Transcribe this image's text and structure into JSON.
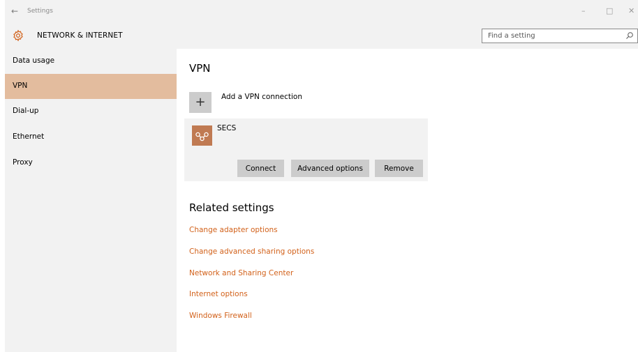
{
  "window": {
    "title": "Settings",
    "back_glyph": "←",
    "minimize_glyph": "–",
    "maximize_glyph": "□",
    "close_glyph": "✕"
  },
  "header": {
    "title": "NETWORK & INTERNET",
    "icon": "gear-icon"
  },
  "search": {
    "placeholder": "Find a setting",
    "value": "",
    "icon": "search-icon"
  },
  "sidebar": {
    "items": [
      {
        "label": "Data usage",
        "active": false
      },
      {
        "label": "VPN",
        "active": true
      },
      {
        "label": "Dial-up",
        "active": false
      },
      {
        "label": "Ethernet",
        "active": false
      },
      {
        "label": "Proxy",
        "active": false
      }
    ]
  },
  "main": {
    "title": "VPN",
    "add_vpn": {
      "plus": "+",
      "label": "Add a VPN connection"
    },
    "connections": [
      {
        "name": "SECS",
        "icon": "vpn-connection-icon",
        "buttons": [
          "Connect",
          "Advanced options",
          "Remove"
        ]
      }
    ],
    "related_title": "Related settings",
    "related_links": [
      "Change adapter options",
      "Change advanced sharing options",
      "Network and Sharing Center",
      "Internet options",
      "Windows Firewall"
    ]
  },
  "colors": {
    "accent": "#d2611a",
    "active_nav": "#e3bc9e",
    "vpn_icon_bg": "#c07a52",
    "chrome_bg": "#f2f2f2",
    "button_bg": "#cccccc"
  }
}
